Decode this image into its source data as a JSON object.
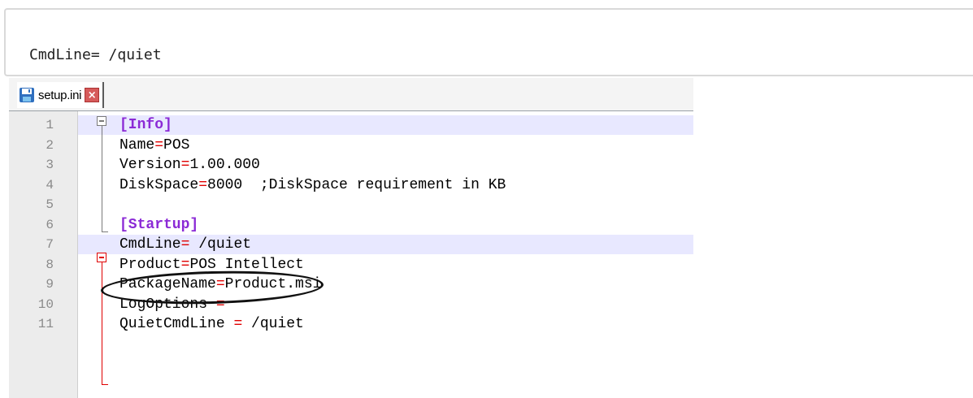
{
  "snippet": {
    "text": "CmdLine= /quiet"
  },
  "editor": {
    "tab": {
      "label": "setup.ini",
      "save_icon": "save-icon",
      "close_icon": "close-icon",
      "close_glyph": "×"
    },
    "lines": [
      {
        "num": "1",
        "parts": [
          {
            "t": "[Info]",
            "c": "sect"
          }
        ]
      },
      {
        "num": "2",
        "parts": [
          {
            "t": "Name"
          },
          {
            "t": "=",
            "c": "eq"
          },
          {
            "t": "POS"
          }
        ]
      },
      {
        "num": "3",
        "parts": [
          {
            "t": "Version"
          },
          {
            "t": "=",
            "c": "eq"
          },
          {
            "t": "1.00.000"
          }
        ]
      },
      {
        "num": "4",
        "parts": [
          {
            "t": "DiskSpace"
          },
          {
            "t": "=",
            "c": "eq"
          },
          {
            "t": "8000  ;DiskSpace requirement in KB"
          }
        ]
      },
      {
        "num": "5",
        "parts": []
      },
      {
        "num": "6",
        "parts": [
          {
            "t": "[Startup]",
            "c": "sect"
          }
        ]
      },
      {
        "num": "7",
        "parts": [
          {
            "t": "CmdLine"
          },
          {
            "t": "=",
            "c": "eq"
          },
          {
            "t": " /quiet"
          }
        ]
      },
      {
        "num": "8",
        "parts": [
          {
            "t": "Product"
          },
          {
            "t": "=",
            "c": "eq"
          },
          {
            "t": "POS Intellect"
          }
        ]
      },
      {
        "num": "9",
        "parts": [
          {
            "t": "PackageName"
          },
          {
            "t": "=",
            "c": "eq"
          },
          {
            "t": "Product.msi"
          }
        ]
      },
      {
        "num": "10",
        "parts": [
          {
            "t": "LogOptions "
          },
          {
            "t": "=",
            "c": "eq"
          }
        ]
      },
      {
        "num": "11",
        "parts": [
          {
            "t": "QuietCmdLine "
          },
          {
            "t": "=",
            "c": "eq"
          },
          {
            "t": " /quiet"
          }
        ]
      }
    ],
    "highlighted_lines": [
      "1",
      "7"
    ],
    "annotation": "circled line 7"
  },
  "colors": {
    "section": "#8b2ad6",
    "operator": "#e00000",
    "line_highlight": "#e8e8ff",
    "fold_gray": "#7a7a7a",
    "fold_red": "#e00000"
  }
}
